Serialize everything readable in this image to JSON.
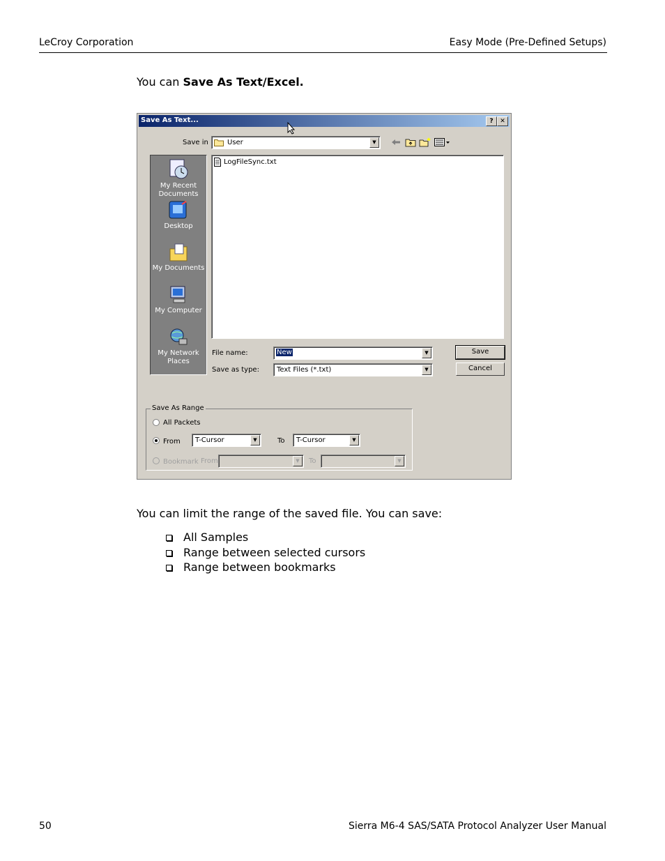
{
  "header": {
    "left": "LeCroy Corporation",
    "right": "Easy Mode (Pre-Defined Setups)"
  },
  "intro": {
    "prefix": "You can ",
    "bold": "Save As Text/Excel."
  },
  "dialog": {
    "title": "Save As Text...",
    "help_button": "?",
    "close_button": "✕",
    "save_in_label": "Save in",
    "save_in_value": "User",
    "places": [
      "My Recent Documents",
      "Desktop",
      "My Documents",
      "My Computer",
      "My Network Places"
    ],
    "files": [
      "LogFileSync.txt"
    ],
    "file_name_label": "File name:",
    "file_name_value": "New",
    "save_as_type_label": "Save as type:",
    "save_as_type_value": "Text Files (*.txt)",
    "save_button": "Save",
    "cancel_button": "Cancel",
    "range": {
      "title": "Save As Range",
      "all_packets": "All Packets",
      "from_label": "From",
      "from_value": "T-Cursor",
      "to_label": "To",
      "to_value": "T-Cursor",
      "bookmark_label": "Bookmark",
      "bm_from_label": "From",
      "bm_to_label": "To",
      "selected": "from"
    }
  },
  "paragraph": "You can limit the range of the saved file. You can save:",
  "bullets": [
    "All Samples",
    "Range between selected cursors",
    "Range between bookmarks"
  ],
  "footer": {
    "page": "50",
    "title": "Sierra M6-4 SAS/SATA Protocol Analyzer User Manual"
  }
}
